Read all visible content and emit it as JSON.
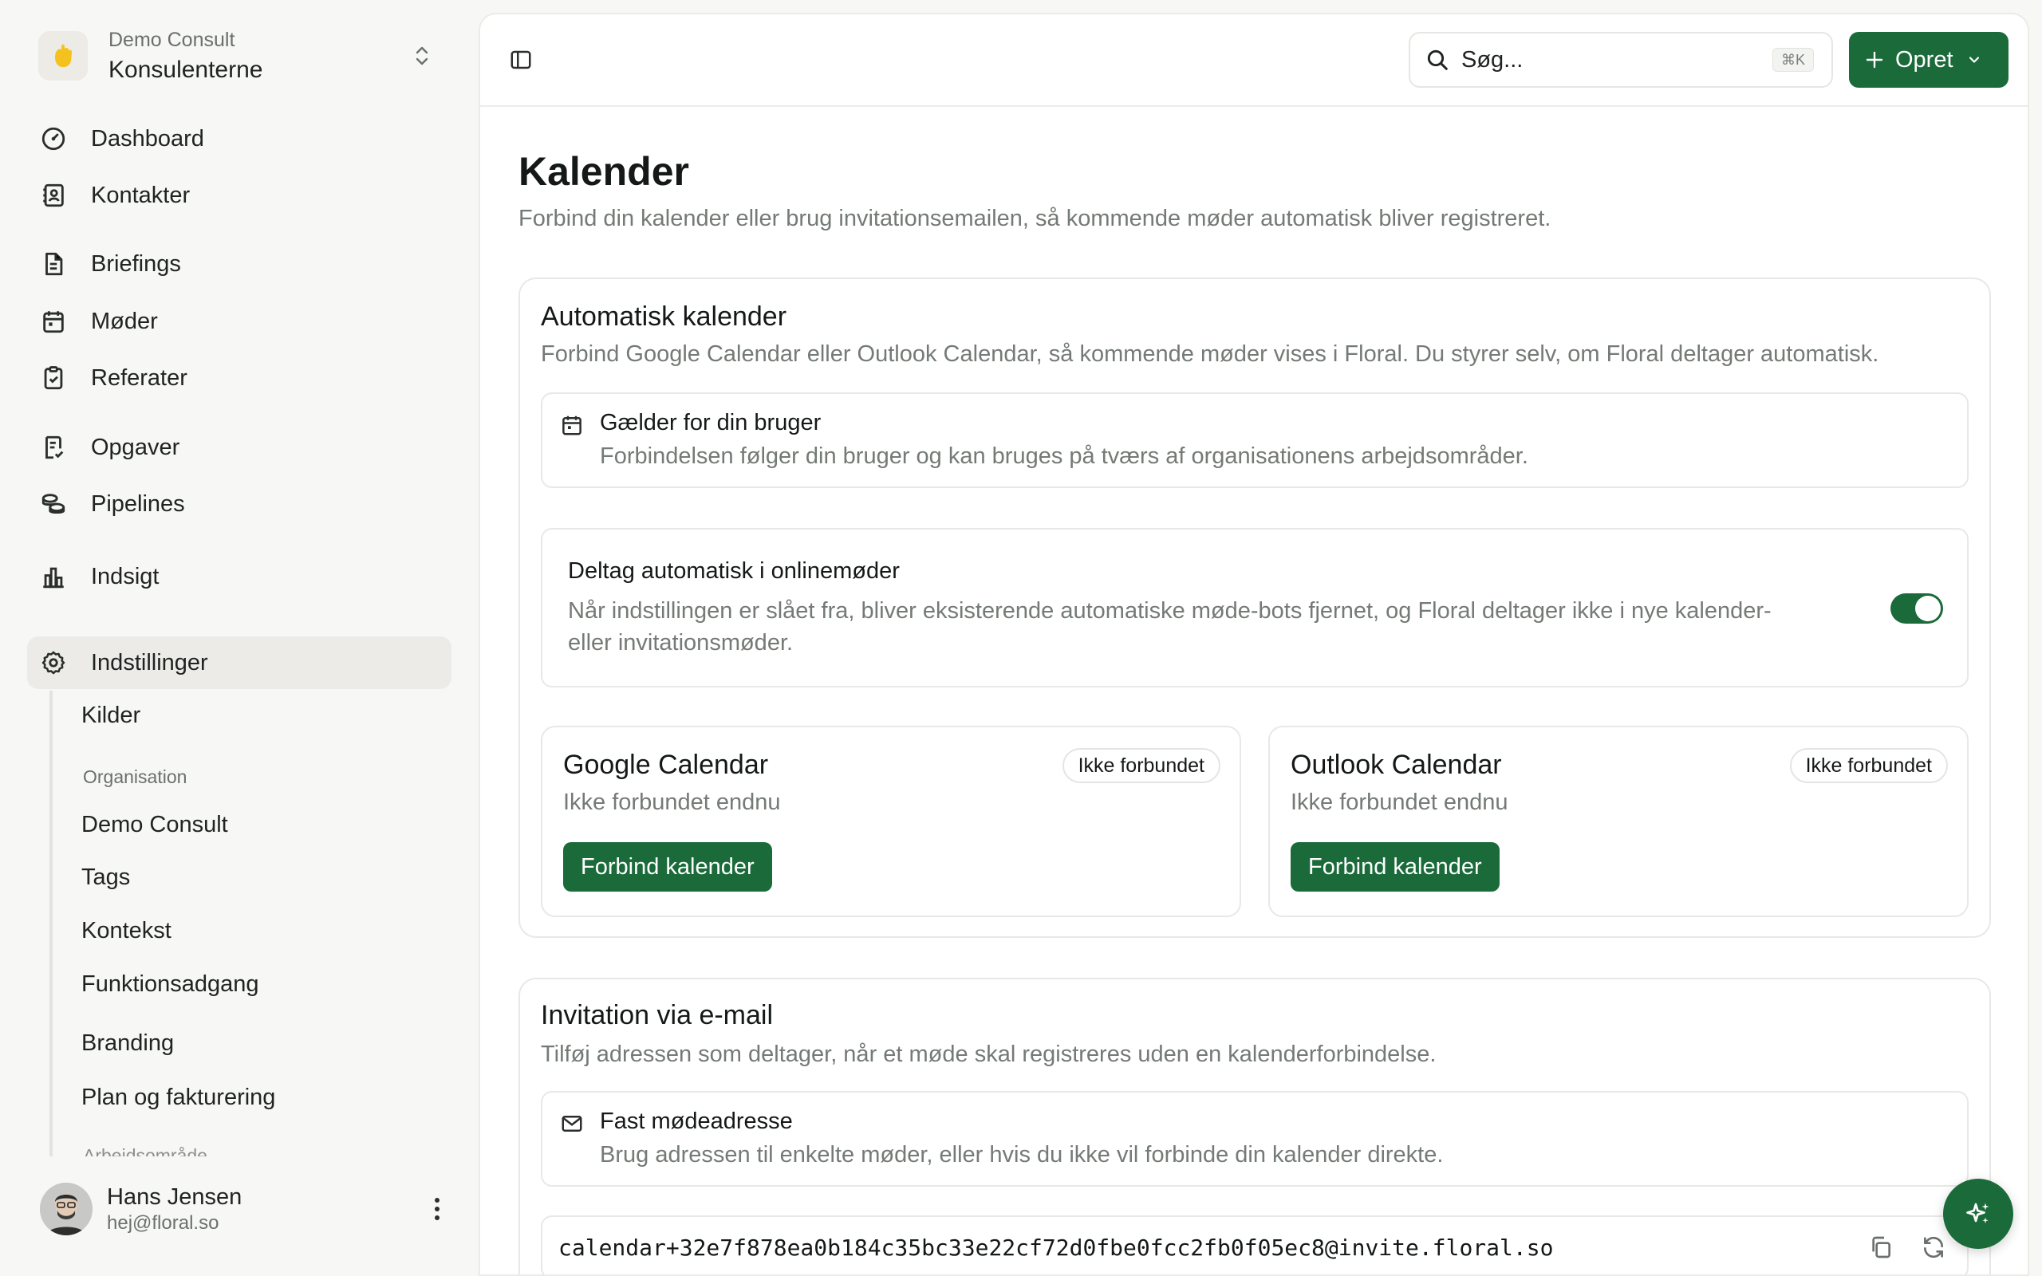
{
  "org": {
    "subtitle": "Demo Consult",
    "name": "Konsulenterne"
  },
  "nav": [
    {
      "label": "Dashboard",
      "icon": "dashboard-gauge-icon"
    },
    {
      "label": "Kontakter",
      "icon": "contacts-book-icon"
    },
    {
      "label": "Briefings",
      "icon": "document-icon"
    },
    {
      "label": "Møder",
      "icon": "calendar-icon"
    },
    {
      "label": "Referater",
      "icon": "clipboard-check-icon"
    },
    {
      "label": "Opgaver",
      "icon": "task-list-icon"
    },
    {
      "label": "Pipelines",
      "icon": "coins-icon"
    },
    {
      "label": "Indsigt",
      "icon": "bar-chart-icon"
    },
    {
      "label": "Indstillinger",
      "icon": "settings-gear-icon",
      "active": true
    }
  ],
  "settings_nav": {
    "kilder": "Kilder",
    "org_heading": "Organisation",
    "items": [
      "Demo Consult",
      "Tags",
      "Kontekst",
      "Funktionsadgang",
      "Branding",
      "Plan og fakturering"
    ],
    "next_heading": "Arbejdsområde"
  },
  "user": {
    "name": "Hans Jensen",
    "email": "hej@floral.so"
  },
  "topbar": {
    "search_placeholder": "Søg...",
    "search_shortcut": "⌘K",
    "create_label": "Opret"
  },
  "page": {
    "title": "Kalender",
    "description": "Forbind din kalender eller brug invitationsemailen, så kommende møder automatisk bliver registreret."
  },
  "auto_calendar": {
    "title": "Automatisk kalender",
    "description": "Forbind Google Calendar eller Outlook Calendar, så kommende møder vises i Floral. Du styrer selv, om Floral deltager automatisk.",
    "scope_title": "Gælder for din bruger",
    "scope_desc": "Forbindelsen følger din bruger og kan bruges på tværs af organisationens arbejdsområder.",
    "join_title": "Deltag automatisk i onlinemøder",
    "join_desc": "Når indstillingen er slået fra, bliver eksisterende automatiske møde-bots fjernet, og Floral deltager ikke i nye kalender- eller invitationsmøder.",
    "join_enabled": true,
    "providers": [
      {
        "name": "Google Calendar",
        "badge": "Ikke forbundet",
        "status": "Ikke forbundet endnu",
        "button": "Forbind kalender"
      },
      {
        "name": "Outlook Calendar",
        "badge": "Ikke forbundet",
        "status": "Ikke forbundet endnu",
        "button": "Forbind kalender"
      }
    ]
  },
  "email_invite": {
    "title": "Invitation via e-mail",
    "description": "Tilføj adressen som deltager, når et møde skal registreres uden en kalenderforbindelse.",
    "fixed_title": "Fast mødeadresse",
    "fixed_desc": "Brug adressen til enkelte møder, eller hvis du ikke vil forbinde din kalender direkte.",
    "address": "calendar+32e7f878ea0b184c35bc33e22cf72d0fbe0fcc2fb0f05ec8@invite.floral.so"
  },
  "colors": {
    "accent": "#1b6b3a",
    "sidebar_bg": "#f7f7f5",
    "muted_text": "#747a75"
  }
}
